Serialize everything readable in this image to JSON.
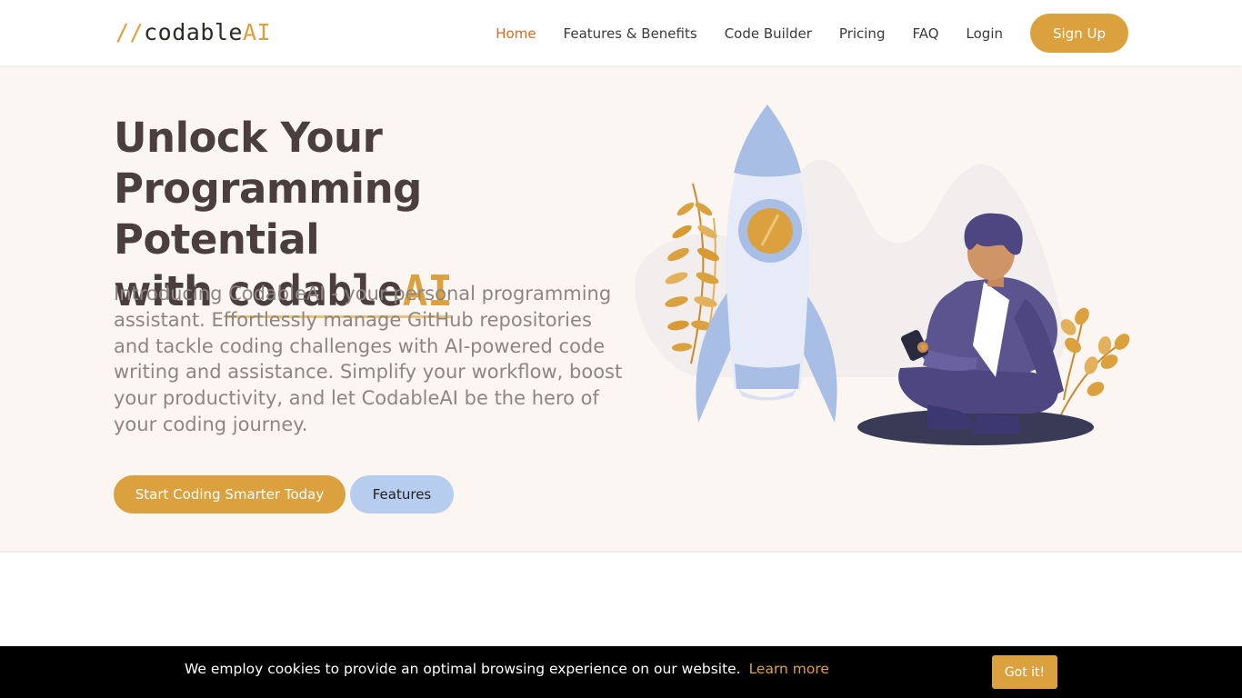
{
  "header": {
    "logo": {
      "slashes": "//",
      "name": "codable",
      "suffix": "AI"
    },
    "nav": [
      {
        "label": "Home",
        "active": true
      },
      {
        "label": "Features & Benefits"
      },
      {
        "label": "Code Builder"
      },
      {
        "label": "Pricing"
      },
      {
        "label": "FAQ"
      },
      {
        "label": "Login"
      }
    ],
    "signup_label": "Sign Up"
  },
  "hero": {
    "title_line1": "Unlock Your",
    "title_line2": "Programming Potential",
    "title_with": "with",
    "title_brand": "codable",
    "title_brand_suffix": "AI",
    "description": "Introducing CodableAI - your personal programming assistant. Effortlessly manage GitHub repositories and tackle coding challenges with AI-powered code writing and assistance. Simplify your workflow, boost your productivity, and let CodableAI be the hero of your coding journey.",
    "primary_button": "Start Coding Smarter Today",
    "secondary_button": "Features",
    "illustration_icon": "rocket-launch-illustration"
  },
  "cookie": {
    "text": "We employ cookies to provide an optimal browsing experience on our website.",
    "link": "Learn more",
    "button": "Got it!"
  },
  "colors": {
    "accent": "#dca13f",
    "active_nav": "#e06a1f",
    "hero_bg": "#fbf6f2",
    "heading": "#4a3f3a",
    "secondary_button": "#b7cdef",
    "cookie_bg": "#000000"
  }
}
